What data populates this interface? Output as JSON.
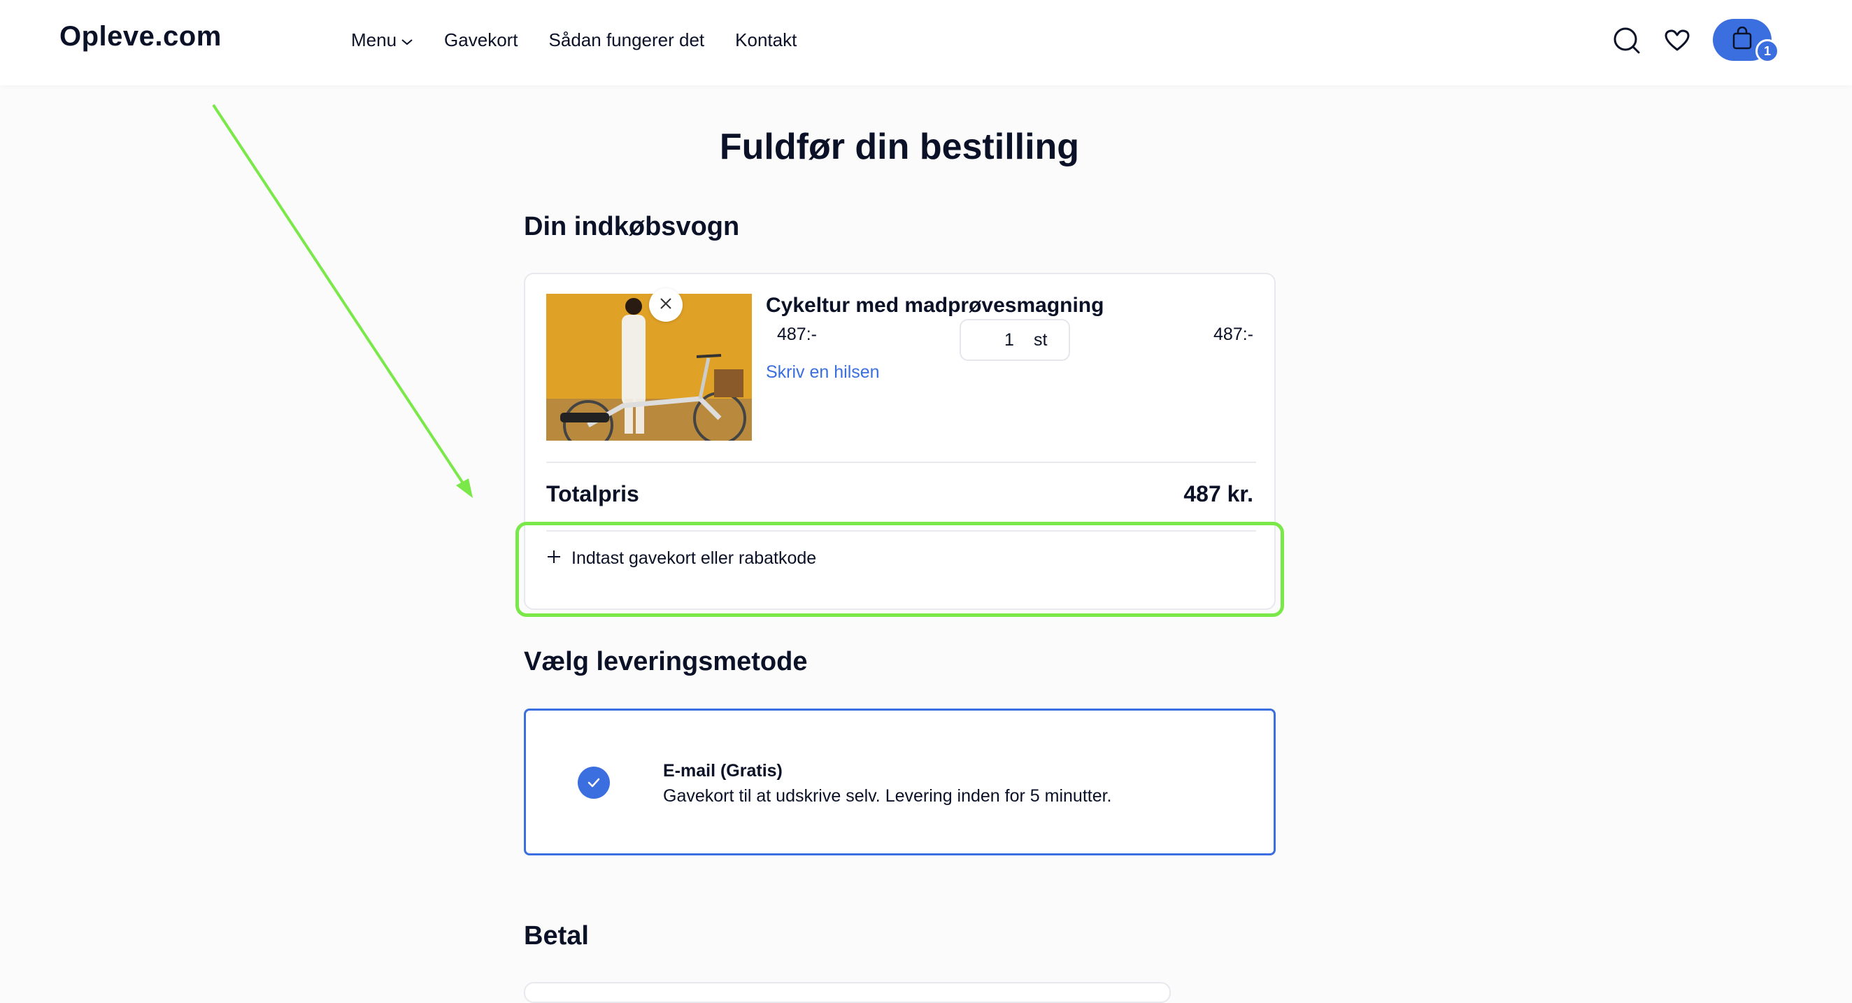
{
  "header": {
    "logo": "Opleve.com",
    "nav": [
      {
        "label": "Menu"
      },
      {
        "label": "Gavekort"
      },
      {
        "label": "Sådan fungerer det"
      },
      {
        "label": "Kontakt"
      }
    ],
    "cart_count": "1",
    "icons": [
      "search-icon",
      "heart-icon",
      "shopping-bag-icon"
    ]
  },
  "main": {
    "title": "Fuldfør din bestilling",
    "cart": {
      "heading": "Din indkøbsvogn",
      "item": {
        "name": "Cykeltur med madprøvesmagning",
        "unit_price": "487:-",
        "quantity": "1",
        "quantity_unit": "st",
        "line_total": "487:-",
        "greeting_link": "Skriv en hilsen"
      },
      "total_label": "Totalpris",
      "total_value": "487 kr.",
      "discount_label": "Indtast gavekort eller rabatkode"
    },
    "delivery": {
      "heading": "Vælg leveringsmetode",
      "option_title": "E-mail (Gratis)",
      "option_desc": "Gavekort til at udskrive selv. Levering inden for 5 minutter."
    },
    "payment": {
      "heading": "Betal"
    }
  },
  "colors": {
    "accent": "#3b6fe0",
    "highlight": "#7be84a",
    "text": "#0b1228"
  }
}
